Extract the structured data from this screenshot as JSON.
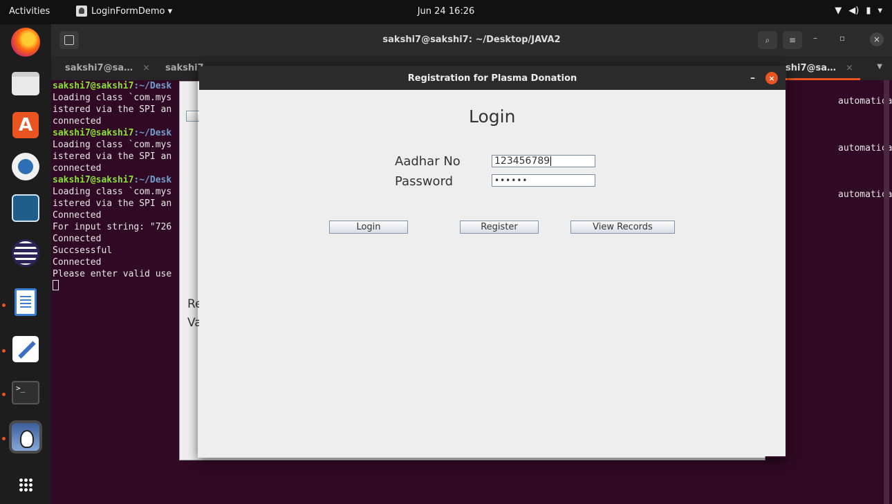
{
  "topbar": {
    "activities": "Activities",
    "app_name": "LoginFormDemo ▾",
    "clock": "Jun 24 16:26",
    "tray": [
      "▼",
      "◀)",
      "▮",
      "▾"
    ]
  },
  "dock": {
    "items": [
      "firefox",
      "files",
      "software-center",
      "app-blue",
      "mysql-workbench",
      "eclipse",
      "libreoffice-writer",
      "text-editor",
      "terminal",
      "java",
      "show-apps"
    ]
  },
  "terminal": {
    "title": "sakshi7@sakshi7: ~/Desktop/JAVA2",
    "tabs": [
      "sakshi7@sa…",
      "sakshi7",
      "shi7@sa…"
    ],
    "tab_close": "×",
    "prompt_user": "sakshi7@sakshi7",
    "prompt_path": ":~/Desk",
    "lines": [
      "Loading class `com.mys",
      "istered via the SPI an",
      "connected",
      "Loading class `com.mys",
      "istered via the SPI an",
      "connected",
      "Loading class `com.mys",
      "istered via the SPI an",
      "Connected",
      "For input string: \"726",
      "Connected",
      "Succsessful",
      "Connected",
      "Please enter valid use"
    ],
    "right_text": "automatically reg",
    "window_min": "–",
    "window_max": "▫",
    "window_close": "×",
    "search_icon": "⌕",
    "menu_icon": "≡"
  },
  "back_window": {
    "label1": "Re",
    "label2": "Va"
  },
  "dialog": {
    "title": "Registration for Plasma Donation",
    "minimize": "–",
    "close": "×",
    "heading": "Login",
    "aadhar_label": "Aadhar No",
    "aadhar_value": "123456789",
    "password_label": "Password",
    "password_value": "••••••",
    "buttons": {
      "login": "Login",
      "register": "Register",
      "view_records": "View Records"
    }
  }
}
